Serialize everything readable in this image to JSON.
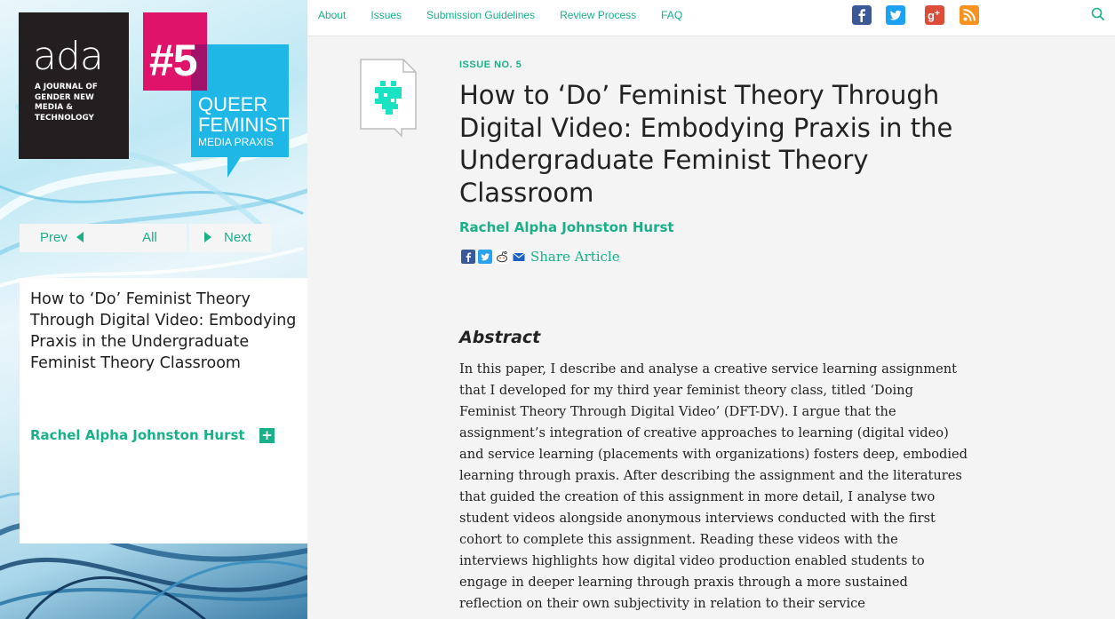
{
  "brand": {
    "logo_word": "ada",
    "logo_tagline": "A Journal of Gender New Media & Technology",
    "issue_number": "#5",
    "issue_theme_line1": "QUEER",
    "issue_theme_line2": "FEMINIST",
    "issue_theme_line3": "MEDIA PRAXIS"
  },
  "nav": {
    "items": [
      {
        "label": "About"
      },
      {
        "label": "Issues"
      },
      {
        "label": "Submission Guidelines"
      },
      {
        "label": "Review Process"
      },
      {
        "label": "FAQ"
      }
    ],
    "social_icons": [
      "facebook-icon",
      "twitter-icon",
      "google-plus-icon",
      "rss-icon"
    ],
    "colors": {
      "facebook": "#3b5998",
      "twitter": "#1da1f2",
      "googleplus": "#dd4b39",
      "rss": "#f7931e"
    }
  },
  "sidebar": {
    "article_title": "How to ‘Do’ Feminist Theory Through Digital Video: Embodying Praxis in the Undergraduate Feminist Theory Classroom",
    "author": "Rachel Alpha Johnston Hurst",
    "plus_label": "+",
    "prev_label": "Prev",
    "all_label": "All",
    "next_label": "Next"
  },
  "article": {
    "issue_label": "ISSUE NO. 5",
    "title": "How to ‘Do’ Feminist Theory Through Digital Video: Embodying Praxis in the Undergraduate Feminist Theory Classroom",
    "author": "Rachel Alpha Johnston Hurst",
    "share_label": "Share Article",
    "abstract_heading": "Abstract",
    "abstract_text": "In this paper, I describe and analyse a creative service learning assignment that I developed for my third year feminist theory class, titled ‘Doing Feminist Theory Through Digital Video’ (DFT-DV). I argue that the assignment’s integration of creative approaches to learning (digital video) and service learning (placements with organizations) fosters deep, embodied learning through praxis. After describing the assignment and the literatures that guided the creation of this assignment in more detail, I analyse two student videos alongside anonymous interviews conducted with the first cohort to complete this assignment. Reading these videos with the interviews highlights how digital video production enabled students to engage in deeper learning through praxis through a more sustained reflection on their own subjectivity in relation to their service"
  },
  "theme": {
    "accent": "#19b08a",
    "magenta": "#e0136b",
    "cyan": "#1fb8e6"
  }
}
